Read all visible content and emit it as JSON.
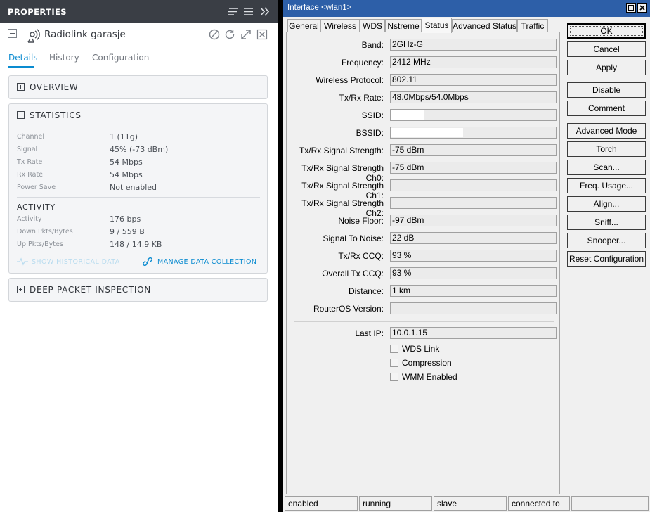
{
  "left_panel": {
    "header_title": "PROPERTIES",
    "device_name": "Radiolink garasje",
    "tabs": [
      "Details",
      "History",
      "Configuration"
    ],
    "sections": {
      "overview": "OVERVIEW",
      "statistics": "STATISTICS",
      "deep_packet": "DEEP PACKET INSPECTION"
    },
    "statistics": [
      {
        "label": "Channel",
        "value": "1 (11g)"
      },
      {
        "label": "Signal",
        "value": "45% (-73 dBm)"
      },
      {
        "label": "Tx Rate",
        "value": "54 Mbps"
      },
      {
        "label": "Rx Rate",
        "value": "54 Mbps"
      },
      {
        "label": "Power Save",
        "value": "Not enabled"
      }
    ],
    "activity_heading": "ACTIVITY",
    "activity": [
      {
        "label": "Activity",
        "value": "176 bps"
      },
      {
        "label": "Down Pkts/Bytes",
        "value": "9 / 559 B"
      },
      {
        "label": "Up Pkts/Bytes",
        "value": "148 / 14.9 KB"
      }
    ],
    "links": {
      "historical": "SHOW HISTORICAL DATA",
      "manage": "MANAGE DATA COLLECTION"
    },
    "colors": {
      "header_bg": "#3a3e45",
      "accent": "#0a8bd0"
    }
  },
  "window": {
    "title": "Interface <wlan1>",
    "tabs": [
      "General",
      "Wireless",
      "WDS",
      "Nstreme",
      "Status",
      "Advanced Status",
      "Traffic"
    ],
    "active_tab": "Status",
    "fields": [
      {
        "label": "Band:",
        "value": "2GHz-G"
      },
      {
        "label": "Frequency:",
        "value": "2412 MHz"
      },
      {
        "label": "Wireless Protocol:",
        "value": "802.11"
      },
      {
        "label": "Tx/Rx Rate:",
        "value": "48.0Mbps/54.0Mbps"
      },
      {
        "label": "SSID:",
        "value": ""
      },
      {
        "label": "BSSID:",
        "value": ""
      },
      {
        "label": "Tx/Rx Signal Strength:",
        "value": "-75 dBm"
      },
      {
        "label": "Tx/Rx Signal Strength Ch0:",
        "value": "-75 dBm"
      },
      {
        "label": "Tx/Rx Signal Strength Ch1:",
        "value": ""
      },
      {
        "label": "Tx/Rx Signal Strength Ch2:",
        "value": ""
      },
      {
        "label": "Noise Floor:",
        "value": "-97 dBm"
      },
      {
        "label": "Signal To Noise:",
        "value": "22 dB"
      },
      {
        "label": "Tx/Rx CCQ:",
        "value": "93 %"
      },
      {
        "label": "Overall Tx CCQ:",
        "value": "93 %"
      },
      {
        "label": "Distance:",
        "value": "1 km"
      },
      {
        "label": "RouterOS Version:",
        "value": ""
      }
    ],
    "last_ip": {
      "label": "Last IP:",
      "value": "10.0.1.15"
    },
    "checkboxes": [
      "WDS Link",
      "Compression",
      "WMM Enabled"
    ],
    "buttons": [
      "OK",
      "Cancel",
      "Apply",
      "Disable",
      "Comment",
      "Advanced Mode",
      "Torch",
      "Scan...",
      "Freq. Usage...",
      "Align...",
      "Sniff...",
      "Snooper...",
      "Reset Configuration"
    ],
    "status_bar": [
      "enabled",
      "running",
      "slave",
      "connected to ess",
      ""
    ],
    "colors": {
      "titlebar": "#2d5fa8",
      "window_bg": "#f0f0f0"
    }
  }
}
